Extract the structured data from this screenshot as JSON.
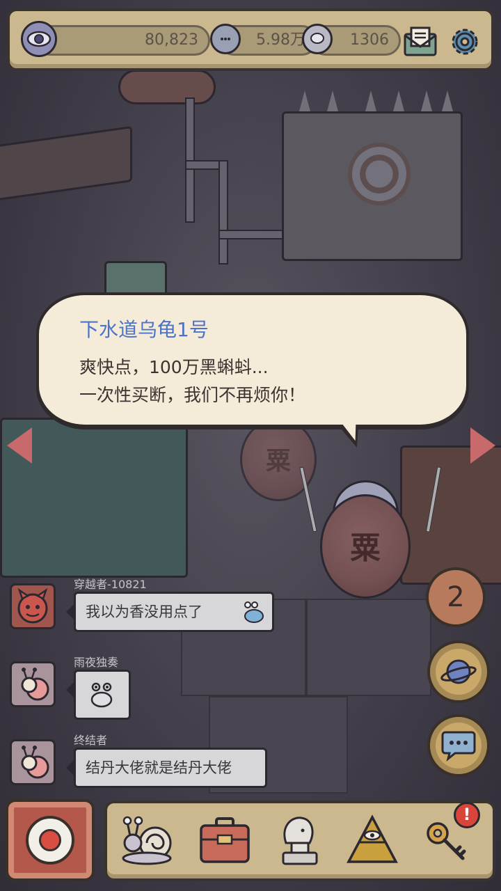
{
  "topbar": {
    "stats": [
      {
        "icon": "eye-icon",
        "value": "80,823"
      },
      {
        "icon": "speech-bubble-icon",
        "value": "5.98万"
      },
      {
        "icon": "chat-bubble-icon",
        "value": "1306"
      }
    ],
    "mail_icon": "mail-icon",
    "settings_icon": "gear-icon"
  },
  "dialogue": {
    "speaker": "下水道乌龟1号",
    "line1": "爽快点，100万黑蝌蚪...",
    "line2": "一次性买断，我们不再烦你！"
  },
  "scene": {
    "turtle_mark": "粟"
  },
  "chat": [
    {
      "user": "穿越者-10821",
      "text": "我以为香没用点了",
      "sticker": "snail-sticker"
    },
    {
      "user": "雨夜独奏",
      "text": "",
      "sticker": "snail-sticker"
    },
    {
      "user": "终结者",
      "text": "结丹大佬就是结丹大佬",
      "sticker": ""
    }
  ],
  "side": {
    "count_badge": "2"
  },
  "bottom": {
    "items": [
      "snail-icon",
      "suitcase-icon",
      "statue-icon",
      "pyramid-eye-icon",
      "key-icon"
    ],
    "alert": "!"
  },
  "colors": {
    "panel": "#cbb88f",
    "accent_red": "#c8696b",
    "speaker_blue": "#4d72c9"
  }
}
